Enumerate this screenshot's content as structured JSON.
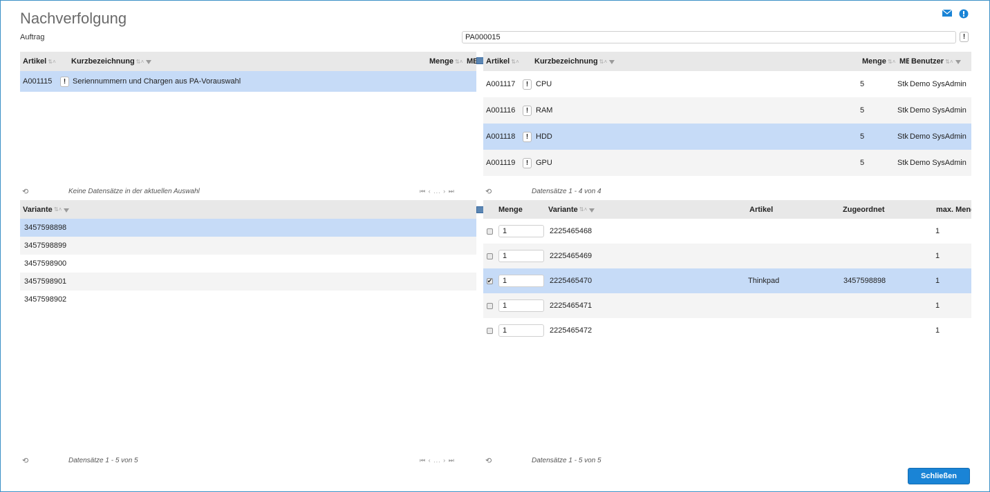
{
  "page": {
    "title": "Nachverfolgung",
    "auftrag_label": "Auftrag",
    "auftrag_value": "PA000015",
    "excl_symbol": "!",
    "close_label": "Schließen"
  },
  "icons": {
    "mail": "mail-icon",
    "help": "help-icon",
    "refresh": "refresh-icon",
    "filter": "filter-icon",
    "sort": "sort-icon",
    "column_chooser": "column-chooser-icon",
    "pager": "pager-icons"
  },
  "icon_glyphs": {
    "sort": "⇅ ˄",
    "refresh": "⟲",
    "checked": "✔",
    "pager_first": "⏮",
    "pager_prev": "‹",
    "pager_ellipsis": "...",
    "pager_next": "›",
    "pager_last": "⏭"
  },
  "colors": {
    "accent": "#1a84d6",
    "selected_row": "#c6dbf7",
    "header_bg": "#e8e8e8",
    "border": "#3a8fc6"
  },
  "auftrag_grid": {
    "headers": {
      "artikel": "Artikel",
      "kurzbezeichnung": "Kurzbezeichnung",
      "menge": "Menge",
      "me": "ME"
    },
    "rows": [
      {
        "artikel": "A001115",
        "kurzbezeichnung": "Seriennummern und Chargen aus PA-Vorauswahl",
        "selected": true
      }
    ],
    "footer": "Keine Datensätze in der aktuellen Auswahl"
  },
  "component_grid": {
    "headers": {
      "artikel": "Artikel",
      "kurzbezeichnung": "Kurzbezeichnung",
      "menge": "Menge",
      "me": "ME",
      "benutzer": "Benutzer"
    },
    "rows": [
      {
        "artikel": "A001117",
        "kurzbezeichnung": "CPU",
        "menge": "5",
        "me": "Stk",
        "benutzer": "Demo SysAdmin",
        "selected": false
      },
      {
        "artikel": "A001116",
        "kurzbezeichnung": "RAM",
        "menge": "5",
        "me": "Stk",
        "benutzer": "Demo SysAdmin",
        "selected": false
      },
      {
        "artikel": "A001118",
        "kurzbezeichnung": "HDD",
        "menge": "5",
        "me": "Stk",
        "benutzer": "Demo SysAdmin",
        "selected": true
      },
      {
        "artikel": "A001119",
        "kurzbezeichnung": "GPU",
        "menge": "5",
        "me": "Stk",
        "benutzer": "Demo SysAdmin",
        "selected": false
      }
    ],
    "footer": "Datensätze 1 - 4 von 4"
  },
  "variant_grid": {
    "headers": {
      "variante": "Variante"
    },
    "rows": [
      {
        "variante": "3457598898",
        "selected": true
      },
      {
        "variante": "3457598899",
        "selected": false
      },
      {
        "variante": "3457598900",
        "selected": false
      },
      {
        "variante": "3457598901",
        "selected": false
      },
      {
        "variante": "3457598902",
        "selected": false
      }
    ],
    "footer": "Datensätze 1 - 5 von 5"
  },
  "assignment_grid": {
    "headers": {
      "menge": "Menge",
      "variante": "Variante",
      "artikel": "Artikel",
      "zugeordnet": "Zugeordnet",
      "max_menge": "max. Menge"
    },
    "rows": [
      {
        "checked": false,
        "menge": "1",
        "variante": "2225465468",
        "artikel": "",
        "zugeordnet": "",
        "max_menge": "1",
        "selected": false
      },
      {
        "checked": false,
        "menge": "1",
        "variante": "2225465469",
        "artikel": "",
        "zugeordnet": "",
        "max_menge": "1",
        "selected": false
      },
      {
        "checked": true,
        "menge": "1",
        "variante": "2225465470",
        "artikel": "Thinkpad",
        "zugeordnet": "3457598898",
        "max_menge": "1",
        "selected": true
      },
      {
        "checked": false,
        "menge": "1",
        "variante": "2225465471",
        "artikel": "",
        "zugeordnet": "",
        "max_menge": "1",
        "selected": false
      },
      {
        "checked": false,
        "menge": "1",
        "variante": "2225465472",
        "artikel": "",
        "zugeordnet": "",
        "max_menge": "1",
        "selected": false
      }
    ],
    "footer": "Datensätze 1 - 5 von 5"
  }
}
